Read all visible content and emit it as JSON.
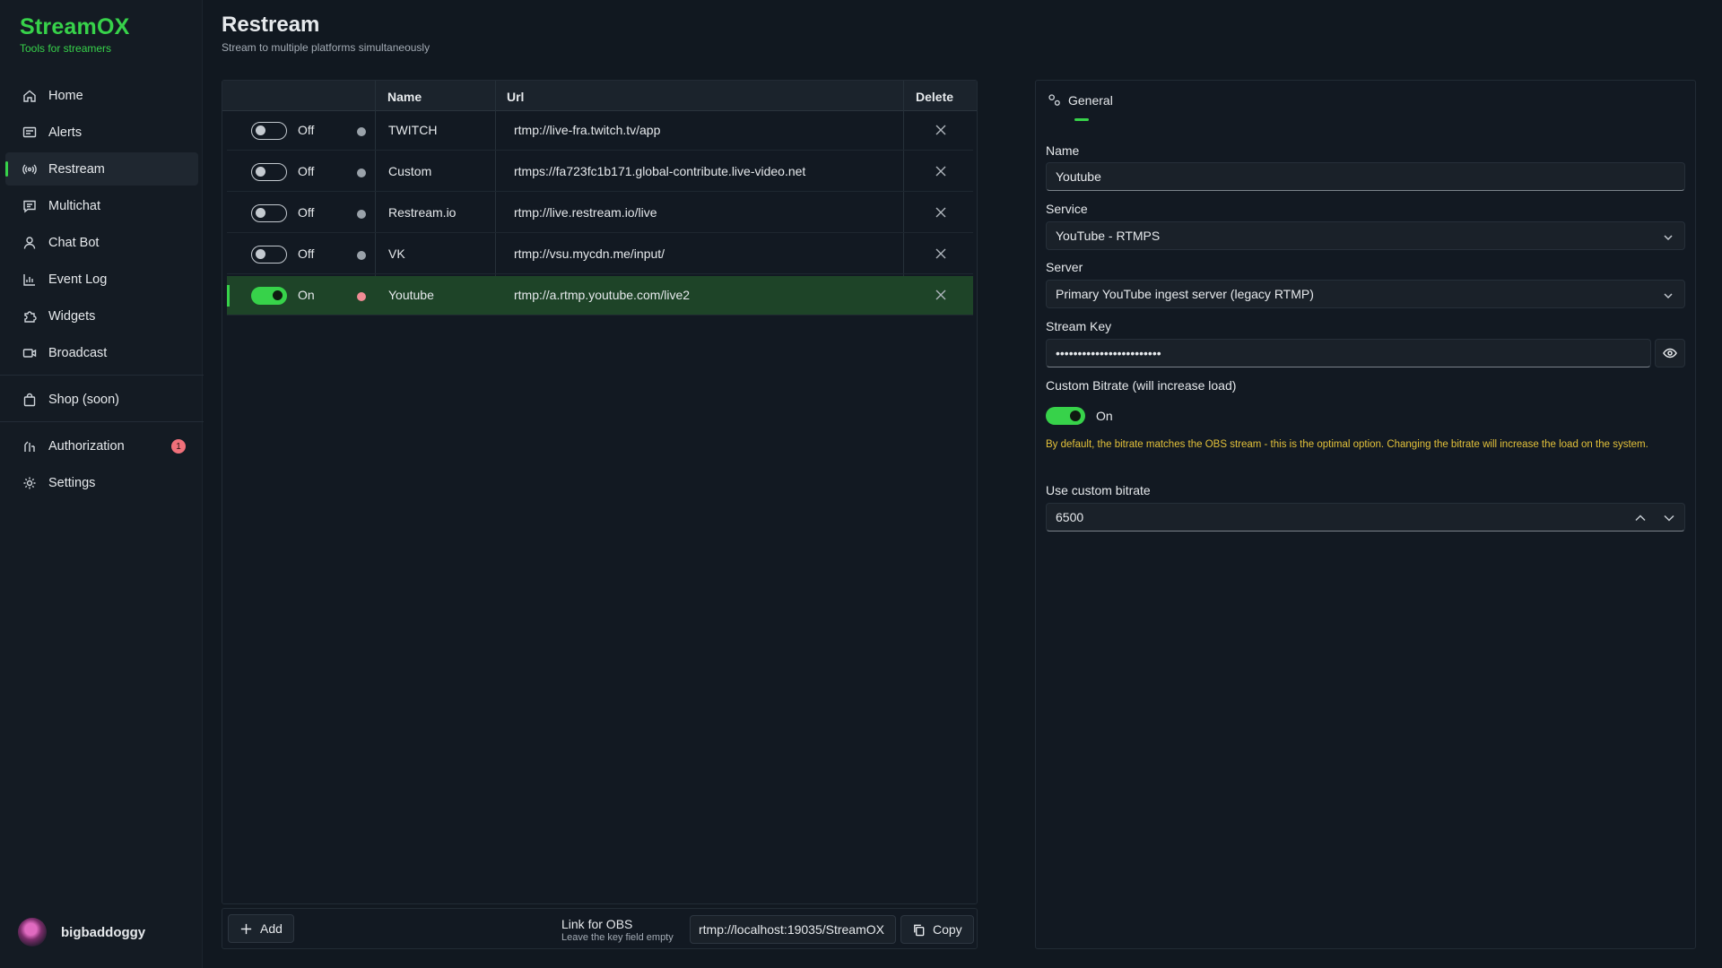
{
  "brand": {
    "title": "StreamOX",
    "subtitle": "Tools for streamers"
  },
  "nav": {
    "home": "Home",
    "alerts": "Alerts",
    "restream": "Restream",
    "multichat": "Multichat",
    "chatbot": "Chat Bot",
    "eventlog": "Event Log",
    "widgets": "Widgets",
    "broadcast": "Broadcast",
    "shop": "Shop (soon)",
    "authorization": "Authorization",
    "authorization_badge": "1",
    "settings": "Settings"
  },
  "user": {
    "name": "bigbaddoggy"
  },
  "page": {
    "title": "Restream",
    "subtitle": "Stream to multiple platforms simultaneously"
  },
  "table": {
    "headers": {
      "name": "Name",
      "url": "Url",
      "delete": "Delete"
    },
    "rows": [
      {
        "state": "Off",
        "enabled": false,
        "name": "TWITCH",
        "url": "rtmp://live-fra.twitch.tv/app"
      },
      {
        "state": "Off",
        "enabled": false,
        "name": "Custom",
        "url": "rtmps://fa723fc1b171.global-contribute.live-video.net"
      },
      {
        "state": "Off",
        "enabled": false,
        "name": "Restream.io",
        "url": "rtmp://live.restream.io/live"
      },
      {
        "state": "Off",
        "enabled": false,
        "name": "VK",
        "url": "rtmp://vsu.mycdn.me/input/"
      },
      {
        "state": "On",
        "enabled": true,
        "name": "Youtube",
        "url": "rtmp://a.rtmp.youtube.com/live2"
      }
    ]
  },
  "footer": {
    "add_label": "Add",
    "obs_label": "Link for OBS",
    "obs_hint": "Leave the key field empty",
    "obs_value": "rtmp://localhost:19035/StreamOX",
    "copy_label": "Copy"
  },
  "settings_panel": {
    "tab_label": "General",
    "name_label": "Name",
    "name_value": "Youtube",
    "service_label": "Service",
    "service_value": "YouTube - RTMPS",
    "server_label": "Server",
    "server_value": "Primary YouTube ingest server (legacy RTMP)",
    "stream_key_label": "Stream Key",
    "stream_key_value": "••••••••••••••••••••••••",
    "custom_bitrate_label": "Custom Bitrate (will increase load)",
    "custom_bitrate_state": "On",
    "custom_bitrate_warning": "By default, the bitrate matches the OBS stream - this is the optimal option. Changing the bitrate will increase the load on the system.",
    "use_custom_bitrate_label": "Use custom bitrate",
    "bitrate_value": "6500"
  },
  "colors": {
    "accent": "#37d24a",
    "warning": "#e3c13a",
    "badge": "#f0707a",
    "live_dot": "#f08b94"
  }
}
